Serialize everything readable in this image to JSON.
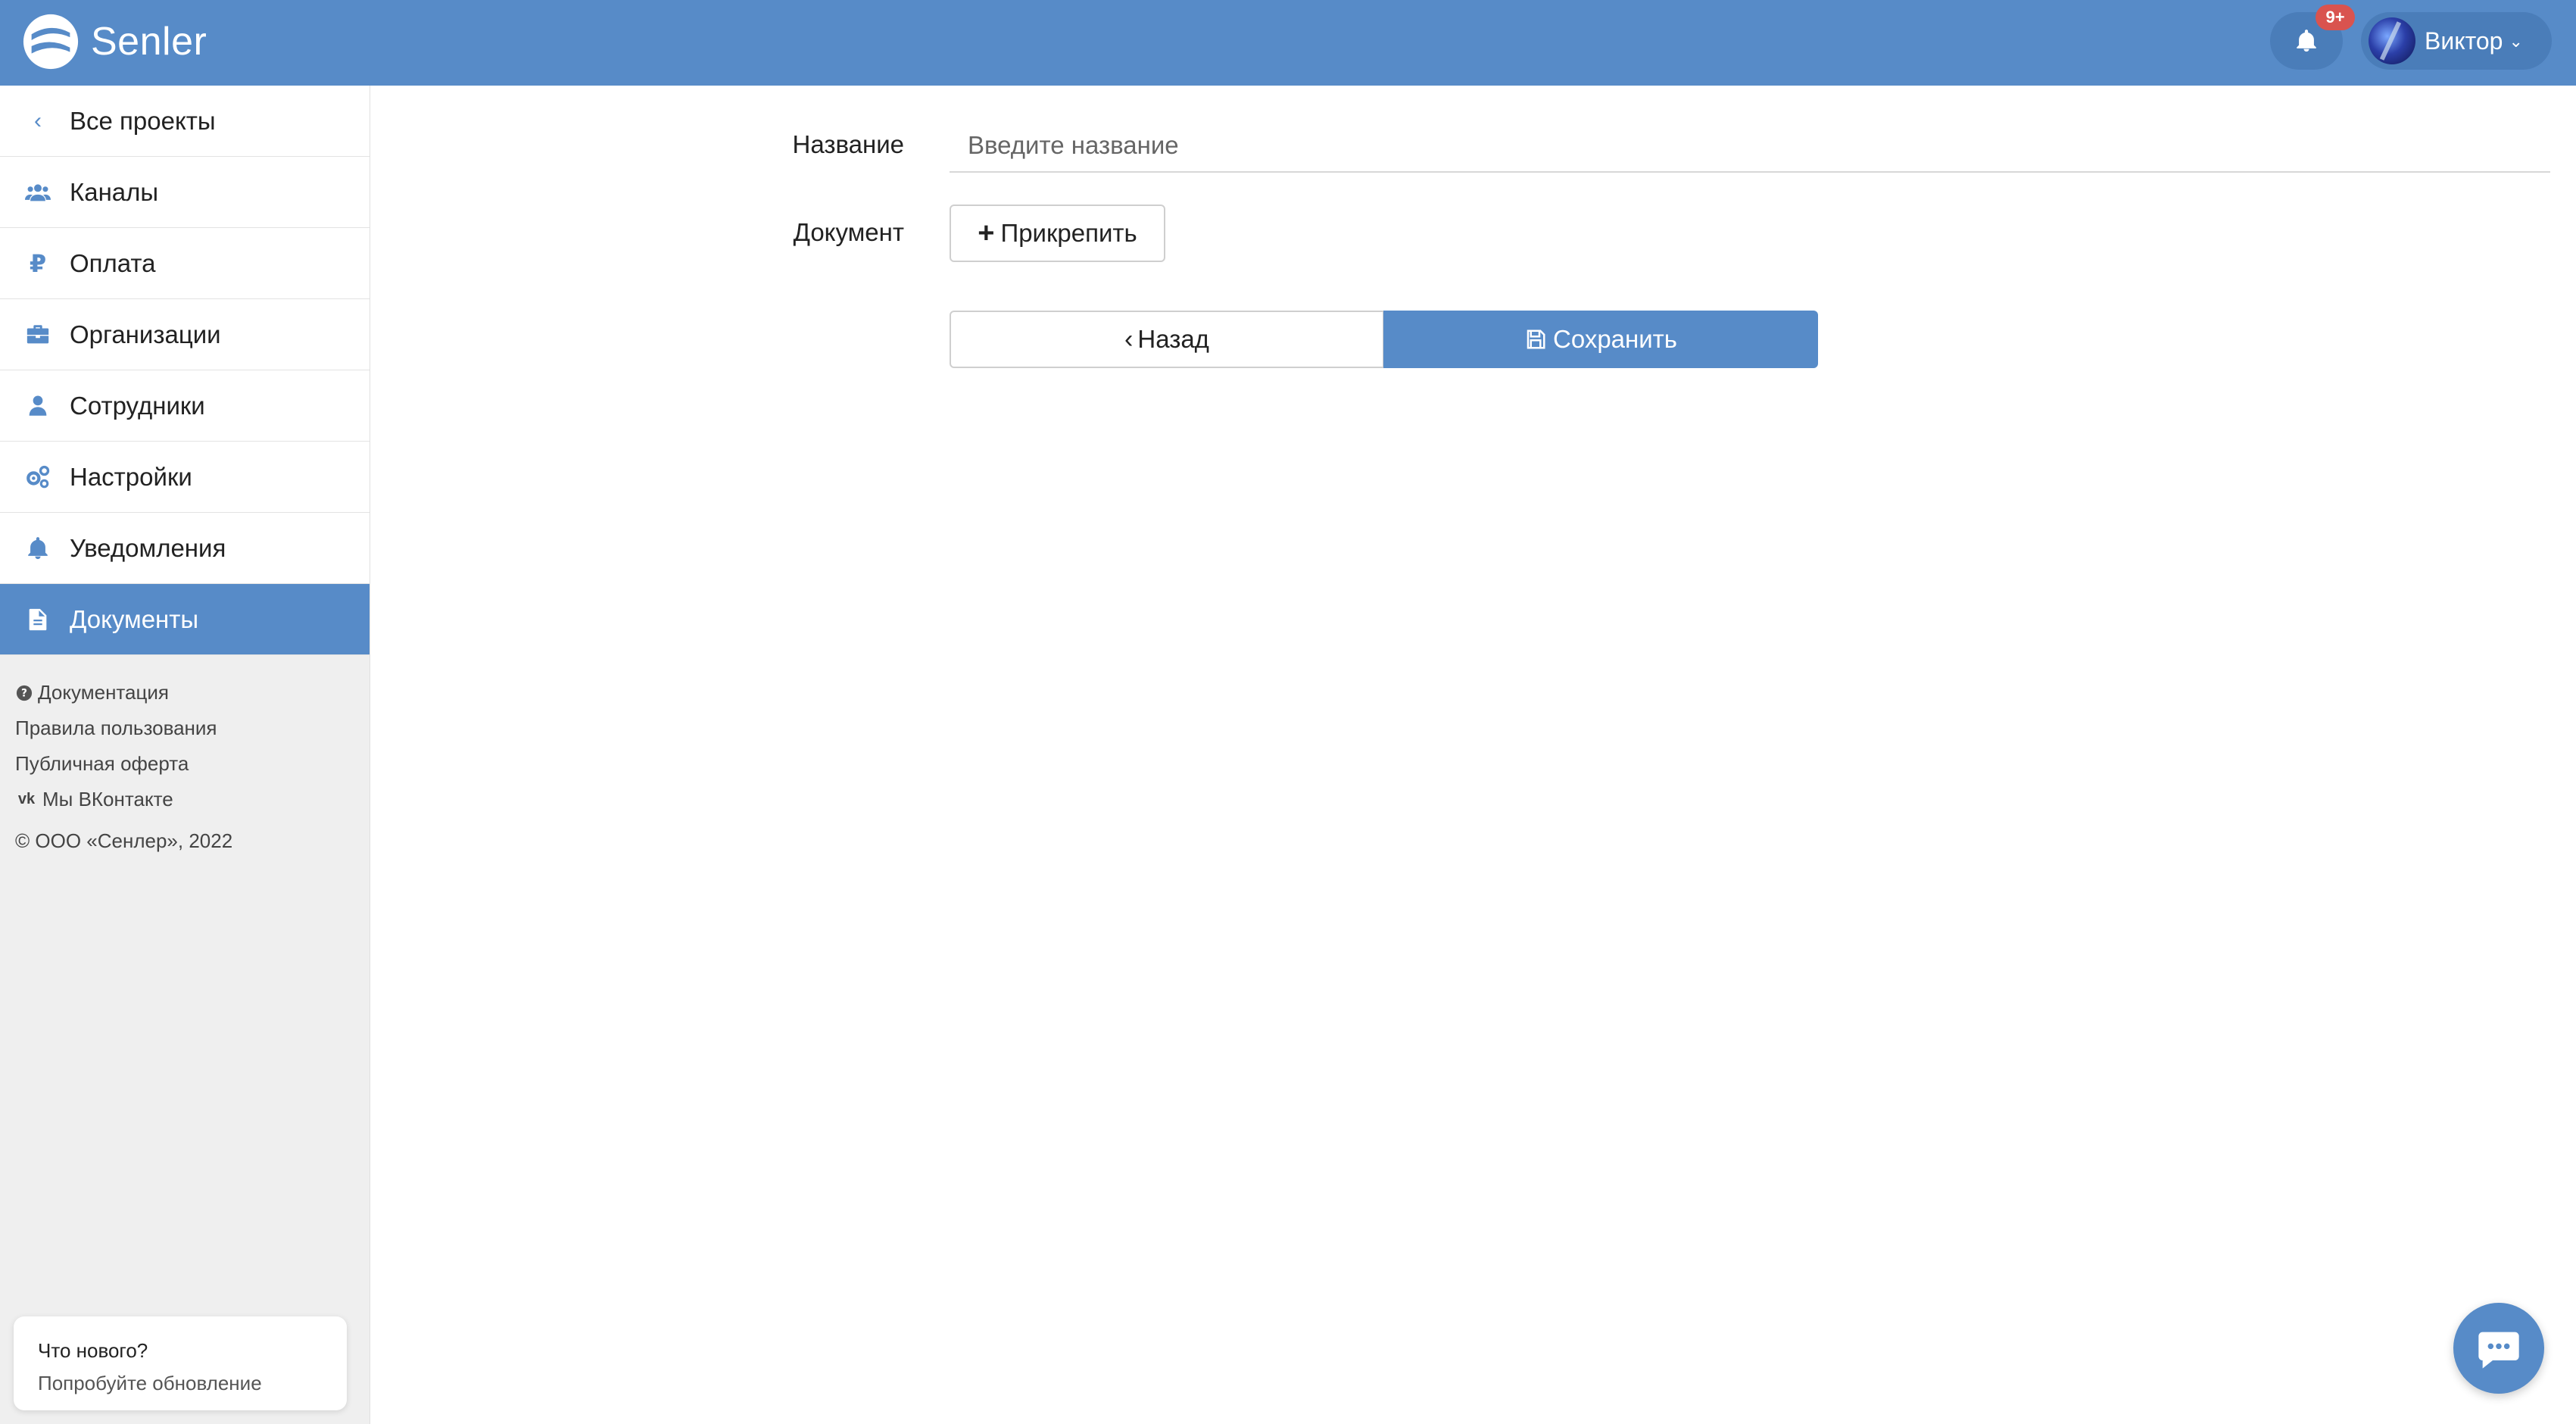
{
  "header": {
    "brand": "Senler",
    "notifications_badge": "9+",
    "user_name": "Виктор"
  },
  "sidebar": {
    "back_label": "Все проекты",
    "items": [
      {
        "label": "Каналы",
        "icon": "users-icon"
      },
      {
        "label": "Оплата",
        "icon": "ruble-icon"
      },
      {
        "label": "Организации",
        "icon": "briefcase-icon"
      },
      {
        "label": "Сотрудники",
        "icon": "user-icon"
      },
      {
        "label": "Настройки",
        "icon": "gears-icon"
      },
      {
        "label": "Уведомления",
        "icon": "bell-icon"
      },
      {
        "label": "Документы",
        "icon": "document-icon",
        "active": true
      }
    ],
    "links": {
      "docs": "Документация",
      "terms": "Правила пользования",
      "offer": "Публичная оферта",
      "vk": "Мы ВКонтакте",
      "copyright": "© ООО «Сенлер», 2022"
    },
    "whats_new": {
      "title": "Что нового?",
      "subtitle": "Попробуйте обновление"
    }
  },
  "form": {
    "name_label": "Название",
    "name_placeholder": "Введите название",
    "name_value": "",
    "document_label": "Документ",
    "attach_label": "Прикрепить",
    "back_label": "Назад",
    "save_label": "Сохранить"
  },
  "colors": {
    "accent": "#578bc8",
    "badge": "#d9534f"
  }
}
